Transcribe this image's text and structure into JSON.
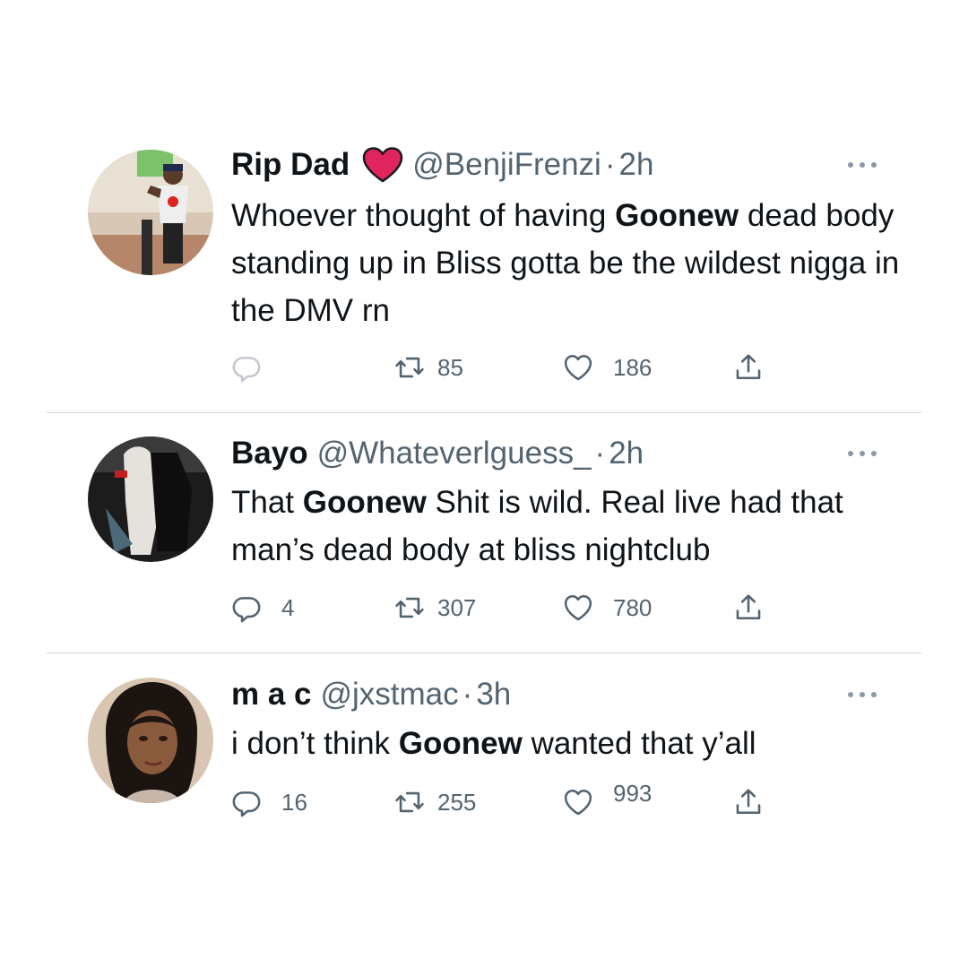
{
  "tweets": [
    {
      "name": "Rip Dad",
      "has_heart_emoji": true,
      "handle": "@BenjiFrenzi",
      "separator": "·",
      "time": "2h",
      "text_parts": [
        "Whoever thought of having ",
        "Goonew",
        " dead body standing up in Bliss gotta be the wildest nigga in the DMV rn"
      ],
      "reply_count": "",
      "retweet_count": "85",
      "like_count": "186"
    },
    {
      "name": "Bayo",
      "handle": "@Whateverlguess_",
      "separator": "·",
      "time": "2h",
      "text_parts": [
        "That ",
        "Goonew",
        " Shit is wild. Real live had that man’s dead body at bliss nightclub"
      ],
      "reply_count": "4",
      "retweet_count": "307",
      "like_count": "780"
    },
    {
      "name": "m a c",
      "handle": "@jxstmac",
      "separator": "·",
      "time": "3h",
      "text_parts": [
        "i don’t think ",
        "Goonew",
        " wanted that y’all"
      ],
      "reply_count": "16",
      "retweet_count": "255",
      "like_count": "993"
    }
  ],
  "colors": {
    "text": "#0f1419",
    "secondary": "#536471",
    "divider": "#cfd9de",
    "heart_emoji": "#e0245e"
  },
  "icons": [
    "reply-icon",
    "retweet-icon",
    "like-icon",
    "share-icon",
    "more-icon",
    "red-heart-emoji"
  ]
}
